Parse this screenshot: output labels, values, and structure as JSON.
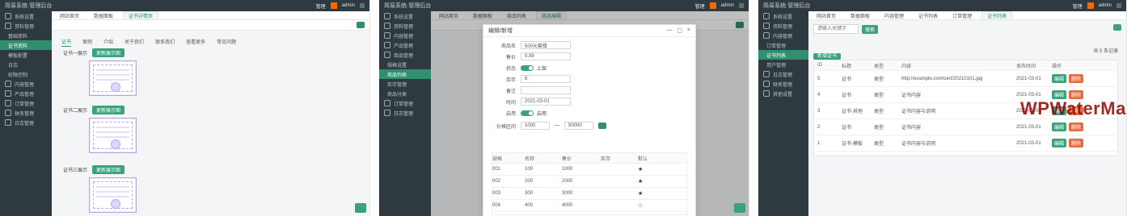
{
  "panels": [
    {
      "topbar": {
        "title": "简易系统·管理后台",
        "right": [
          "管理",
          "admin"
        ]
      },
      "sidebar": [
        {
          "label": "系统设置",
          "active": false
        },
        {
          "label": "资料管理",
          "active": false
        },
        {
          "label": "基础资料",
          "active": false
        },
        {
          "label": "证书资料",
          "active": true
        },
        {
          "label": "模板配置",
          "active": false
        },
        {
          "label": "日志",
          "active": false
        },
        {
          "label": "权限控制",
          "active": false
        },
        {
          "label": "内容管理",
          "active": false
        },
        {
          "label": "产品管理",
          "active": false
        },
        {
          "label": "订单管理",
          "active": false
        },
        {
          "label": "财务管理",
          "active": false
        },
        {
          "label": "日志管理",
          "active": false
        }
      ],
      "tabs": [
        "网站首页",
        "数据面板",
        "证书详情页"
      ],
      "subtabs": [
        "证书",
        "案例",
        "介绍",
        "关于我们",
        "联系我们",
        "查看更多",
        "常见问题"
      ],
      "rows": [
        {
          "label": "证书一展示",
          "button": "更新展示图"
        },
        {
          "label": "证书二展示",
          "button": "更新展示图"
        },
        {
          "label": "证书三展示",
          "button": "更新展示图"
        }
      ]
    },
    {
      "topbar": {
        "title": "简易系统·管理后台",
        "right": [
          "管理",
          "admin"
        ]
      },
      "sidebar": [
        {
          "label": "系统设置",
          "active": false
        },
        {
          "label": "资料管理",
          "active": false
        },
        {
          "label": "内容管理",
          "active": false
        },
        {
          "label": "产品管理",
          "active": false
        },
        {
          "label": "商品管理",
          "active": false
        },
        {
          "label": "规格设置",
          "active": false
        },
        {
          "label": "商品列表",
          "active": true
        },
        {
          "label": "库存管理",
          "active": false
        },
        {
          "label": "商品分类",
          "active": false
        },
        {
          "label": "订单管理",
          "active": false
        },
        {
          "label": "日志管理",
          "active": false
        }
      ],
      "tabs": [
        "网站首页",
        "数据面板",
        "商品列表",
        "商品编辑"
      ],
      "modal": {
        "title": "编辑/新增",
        "fields": [
          {
            "label": "商品名",
            "value": "500元套餐"
          },
          {
            "label": "售价",
            "value": "9.99"
          },
          {
            "label": "状态",
            "value": "上架"
          },
          {
            "label": "库存",
            "value": "6"
          },
          {
            "label": "备注",
            "value": ""
          },
          {
            "label": "时间",
            "value": "2021-03-01"
          },
          {
            "label": "启用",
            "value": "启用"
          }
        ],
        "range": {
          "label": "价格区间",
          "from": "1000",
          "to": "50000"
        },
        "table": {
          "headers": [
            "规格",
            "名称",
            "售价",
            "库存",
            "默认"
          ],
          "rows": [
            [
              "001",
              "100",
              "1000",
              "",
              "★"
            ],
            [
              "002",
              "200",
              "2000",
              "",
              "★"
            ],
            [
              "003",
              "300",
              "3000",
              "",
              "★"
            ],
            [
              "004",
              "400",
              "4000",
              "",
              "☆"
            ]
          ]
        }
      }
    },
    {
      "topbar": {
        "title": "简易系统·管理后台",
        "right": [
          "管理",
          "admin"
        ]
      },
      "sidebar": [
        {
          "label": "系统设置",
          "active": false
        },
        {
          "label": "资料管理",
          "active": false
        },
        {
          "label": "内容管理",
          "active": false
        },
        {
          "label": "订单管理",
          "active": false
        },
        {
          "label": "证书列表",
          "active": true
        },
        {
          "label": "用户管理",
          "active": false
        },
        {
          "label": "日志管理",
          "active": false
        },
        {
          "label": "财务管理",
          "active": false
        },
        {
          "label": "其他设置",
          "active": false
        }
      ],
      "tabs": [
        "网站首页",
        "数据面板",
        "内容管理",
        "证书列表",
        "订单管理",
        "证书列表"
      ],
      "search": {
        "placeholder": "请输入关键字",
        "button": "搜索"
      },
      "actions": {
        "add": "新增证书"
      },
      "filter": "共 5 条记录",
      "table": {
        "headers": [
          "ID",
          "标题",
          "类型",
          "内容",
          "发布时间",
          "操作"
        ],
        "rows": [
          {
            "id": "5",
            "title": "证书",
            "type": "类型",
            "content": "http://example.com/cert/20210101.jpg",
            "time": "2021-03-01",
            "ops": [
              "编辑",
              "删除"
            ]
          },
          {
            "id": "4",
            "title": "证书",
            "type": "类型",
            "content": "证书内容",
            "time": "2021-03-01",
            "ops": [
              "编辑",
              "删除"
            ]
          },
          {
            "id": "3",
            "title": "证书·其他",
            "type": "类型",
            "content": "证书内容与说明",
            "time": "2021-03-01",
            "ops": [
              "编辑",
              "删除"
            ]
          },
          {
            "id": "2",
            "title": "证书",
            "type": "类型",
            "content": "证书内容",
            "time": "2021-03-01",
            "ops": [
              "编辑",
              "删除"
            ]
          },
          {
            "id": "1",
            "title": "证书·模板",
            "type": "类型",
            "content": "证书内容与说明",
            "time": "2021-03-01",
            "ops": [
              "编辑",
              "删除"
            ]
          }
        ]
      },
      "watermark": "WPWaterMark"
    }
  ]
}
